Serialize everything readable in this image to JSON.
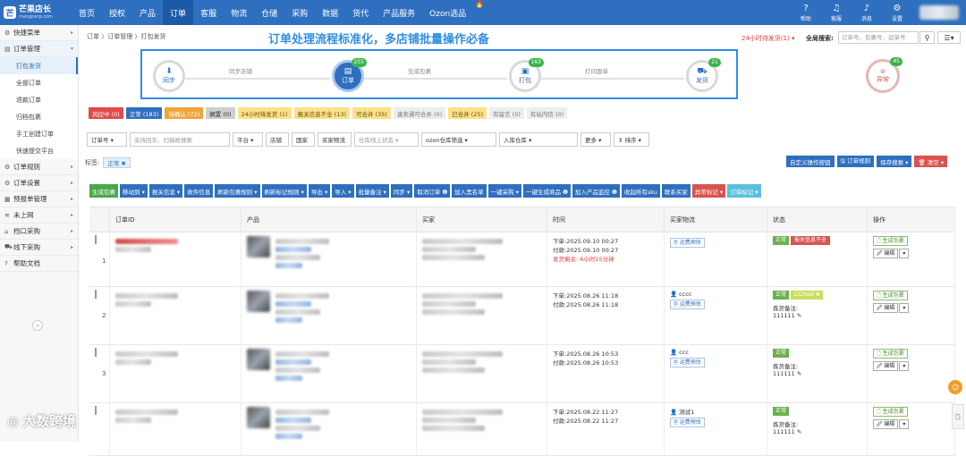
{
  "app": {
    "logo_text": "芒果店长",
    "logo_sub": "mangoerp.com"
  },
  "nav": [
    "首页",
    "授权",
    "产品",
    "订单",
    "客服",
    "物流",
    "仓储",
    "采购",
    "数据",
    "货代",
    "产品服务",
    "Ozon选品"
  ],
  "top_right": [
    {
      "icon": "question-icon",
      "label": "帮助"
    },
    {
      "icon": "bell-icon",
      "label": "客服"
    },
    {
      "icon": "message-icon",
      "label": "消息"
    },
    {
      "icon": "gear-icon",
      "label": "设置"
    }
  ],
  "sidebar": {
    "groups": [
      {
        "label": "快捷菜单",
        "icon": "gear-icon"
      },
      {
        "label": "订单管理",
        "icon": "list-icon"
      }
    ],
    "subs": [
      "打包发货",
      "全部订单",
      "退款订单",
      "归档包裹",
      "手工创建订单",
      "快速提交平台"
    ],
    "more": [
      {
        "label": "订单规则",
        "icon": "gear-icon"
      },
      {
        "label": "订单设置",
        "icon": "gear-icon"
      },
      {
        "label": "预报单管理",
        "icon": "calendar-icon"
      },
      {
        "label": "未上网",
        "icon": "wifi-icon"
      },
      {
        "label": "档口采购",
        "icon": "shop-icon"
      },
      {
        "label": "线下采购",
        "icon": "cart-icon"
      },
      {
        "label": "帮助文档",
        "icon": "help-icon"
      }
    ]
  },
  "breadcrumb": "订单 〉订单管理 〉打包发货",
  "headline": "订单处理流程标准化，多店铺批量操作必备",
  "pending": "24小时待发货(1) ▾",
  "search": {
    "label": "全局搜索:",
    "placeholder": "订单号、包裹号、运单号"
  },
  "flow": {
    "steps": [
      {
        "label": "同步",
        "badge": ""
      },
      {
        "label": "订单",
        "badge": "255"
      },
      {
        "label": "打包",
        "badge": "163"
      },
      {
        "label": "发货",
        "badge": "21"
      }
    ],
    "links": [
      "同步店铺",
      "生成包裹",
      "打印面单"
    ],
    "abnormal": {
      "label": "异常",
      "badge": "45"
    }
  },
  "tabs": [
    {
      "label": "风控中 (0)",
      "style": "t-red"
    },
    {
      "label": "正常 (183)",
      "style": "t-blue"
    },
    {
      "label": "待确认 (72)",
      "style": "t-orange"
    },
    {
      "label": "搁置 (0)",
      "style": "t-gray"
    },
    {
      "label": "24小时待发货 (1)",
      "style": "t-yellow"
    },
    {
      "label": "报关信息不全 (13)",
      "style": "t-yellow"
    },
    {
      "label": "可合并 (35)",
      "style": "t-yellow"
    },
    {
      "label": "速卖通可合并 (0)",
      "style": "t-lgray"
    },
    {
      "label": "已合并 (25)",
      "style": "t-yellow"
    },
    {
      "label": "有留言 (0)",
      "style": "t-lgray"
    },
    {
      "label": "有站内信 (0)",
      "style": "t-lgray"
    }
  ],
  "filters": [
    "订单号 ▾",
    "支持回车、扫描枪搜索",
    "平台 ▾",
    "店铺",
    "国家",
    "买家物流",
    "仓库线上状态 ▾",
    "ozon仓库筛选 ▾",
    "入库仓库 ▾",
    "更多 ▾",
    "⇕ 排序 ▾"
  ],
  "tag_row": {
    "label": "标签:",
    "tag": "正常 ✖"
  },
  "right_buttons": [
    {
      "label": "自定义操作按钮",
      "style": "blue"
    },
    {
      "label": "🖫 订单规则",
      "style": "blue"
    },
    {
      "label": "保存搜索 ▾",
      "style": "blue"
    },
    {
      "label": "🗑 清空 ▾",
      "style": "red"
    }
  ],
  "actions": [
    {
      "label": "生成包裹",
      "style": "green"
    },
    {
      "label": "移动到 ▾",
      "style": ""
    },
    {
      "label": "报关信息 ▾",
      "style": ""
    },
    {
      "label": "收件信息",
      "style": ""
    },
    {
      "label": "刷新包裹规则 ▾",
      "style": ""
    },
    {
      "label": "刷新标记规则 ▾",
      "style": ""
    },
    {
      "label": "导出 ▾",
      "style": ""
    },
    {
      "label": "导入 ▾",
      "style": ""
    },
    {
      "label": "批量备注 ▾",
      "style": ""
    },
    {
      "label": "同步 ▾",
      "style": ""
    },
    {
      "label": "取消订单 ❶",
      "style": ""
    },
    {
      "label": "加入黑名单",
      "style": ""
    },
    {
      "label": "一键采购 ▾",
      "style": ""
    },
    {
      "label": "一键生成商品 ❶",
      "style": ""
    },
    {
      "label": "加入产品监控 ❶",
      "style": ""
    },
    {
      "label": "收起所有sku",
      "style": ""
    },
    {
      "label": "联系买家",
      "style": ""
    },
    {
      "label": "异常标记 ▾",
      "style": "red"
    },
    {
      "label": "订单标记 ▾",
      "style": "teal"
    }
  ],
  "columns": [
    "",
    "订单ID",
    "产品",
    "买家",
    "时间",
    "买家物流",
    "状态",
    "操作"
  ],
  "rows": [
    {
      "n": "1",
      "t1": "下单:2025.09.10 00:27",
      "t2": "付款:2025.09.10 00:27",
      "t3": "发货剩余: 6小时15分钟",
      "buyer": "",
      "status": "正常",
      "warn": "报关信息不全",
      "tag": "",
      "note": "",
      "note2": ""
    },
    {
      "n": "2",
      "t1": "下单:2025.08.26 11:18",
      "t2": "付款:2025.08.26 11:18",
      "t3": "",
      "buyer": "cccc",
      "status": "正常",
      "warn": "",
      "tag": "122test ✖",
      "note": "拣货备注:",
      "note2": "111111"
    },
    {
      "n": "3",
      "t1": "下单:2025.08.26 10:53",
      "t2": "付款:2025.08.26 10:53",
      "t3": "",
      "buyer": "ccc",
      "status": "正常",
      "warn": "",
      "tag": "",
      "note": "拣货备注:",
      "note2": "111111"
    },
    {
      "n": "",
      "t1": "下单:2025.08.22 11:27",
      "t2": "付款:2025.08.22 11:27",
      "t3": "",
      "buyer": "测试1",
      "status": "正常",
      "warn": "",
      "tag": "",
      "note": "拣货备注:",
      "note2": "111111"
    }
  ],
  "row_common": {
    "logistics_btn": "🗏 运费预估",
    "op_generate": "🗋 生成包裹",
    "op_edit": "🖉 编辑",
    "op_dropdown": "▾"
  },
  "watermark": "大数跨境",
  "float_side": "📋"
}
